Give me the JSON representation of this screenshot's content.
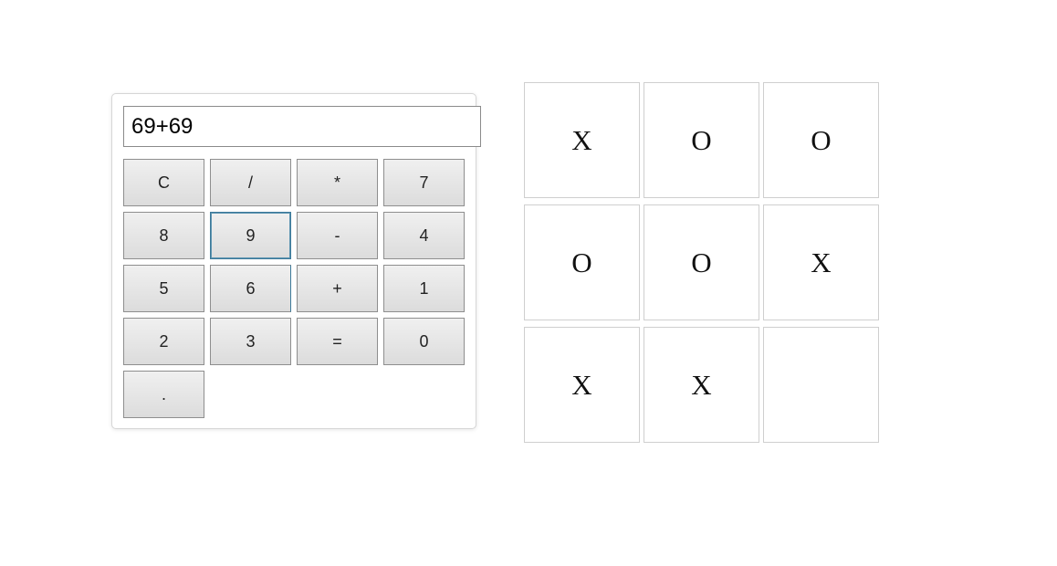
{
  "calculator": {
    "display_value": "69+69",
    "keys": [
      {
        "label": "C",
        "name": "clear-button"
      },
      {
        "label": "/",
        "name": "divide-button"
      },
      {
        "label": "*",
        "name": "multiply-button"
      },
      {
        "label": "7",
        "name": "digit-7-button"
      },
      {
        "label": "8",
        "name": "digit-8-button"
      },
      {
        "label": "9",
        "name": "digit-9-button"
      },
      {
        "label": "-",
        "name": "subtract-button"
      },
      {
        "label": "4",
        "name": "digit-4-button"
      },
      {
        "label": "5",
        "name": "digit-5-button"
      },
      {
        "label": "6",
        "name": "digit-6-button"
      },
      {
        "label": "+",
        "name": "add-button"
      },
      {
        "label": "1",
        "name": "digit-1-button"
      },
      {
        "label": "2",
        "name": "digit-2-button"
      },
      {
        "label": "3",
        "name": "digit-3-button"
      },
      {
        "label": "=",
        "name": "equals-button"
      },
      {
        "label": "0",
        "name": "digit-0-button"
      },
      {
        "label": ".",
        "name": "decimal-button"
      }
    ]
  },
  "tictactoe": {
    "cells": [
      "X",
      "O",
      "O",
      "O",
      "O",
      "X",
      "X",
      "X",
      ""
    ]
  },
  "colors": {
    "focus_border": "#3d7a9a",
    "cell_border": "#cfcfcf",
    "key_border": "#8e8e8e"
  }
}
